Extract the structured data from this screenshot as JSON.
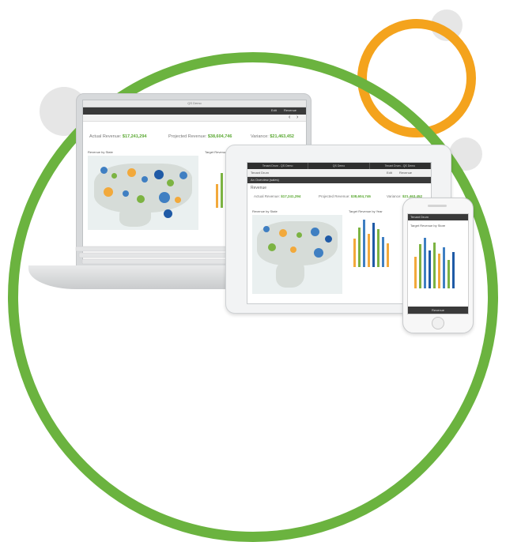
{
  "colors": {
    "green_arc": "#6bb33f",
    "orange_ring": "#f4a31d",
    "kpi_green": "#5aa832"
  },
  "laptop": {
    "window_title": "QS Demo",
    "toolbar_tabs": [
      "Edit",
      "Revenue"
    ],
    "kpis": [
      {
        "label": "Actual Revenue:",
        "value": "$17,241,294"
      },
      {
        "label": "Projected Revenue:",
        "value": "$38,604,746"
      },
      {
        "label": "Variance:",
        "value": "$21,463,452"
      }
    ],
    "map_title": "Revenue by State",
    "chart_title": "Target Revenue by Year",
    "nav_prev": "‹",
    "nav_next": "›"
  },
  "tablet": {
    "tabs": [
      "Tenant Drum - QS Demo",
      "QS Demo",
      "Tenant Drum - QS Demo"
    ],
    "app_name": "Tenant Drum",
    "toolbar_tabs": [
      "Edit",
      "Revenue"
    ],
    "breadcrumb": "An Overview (sales)",
    "section": "Revenue",
    "kpis": [
      {
        "label": "Actual Revenue:",
        "value": "$17,241,294"
      },
      {
        "label": "Projected Revenue:",
        "value": "$38,604,746"
      },
      {
        "label": "Variance:",
        "value": "$21,463,452"
      }
    ],
    "map_title": "Revenue by State",
    "chart_title": "Target Revenue by Year"
  },
  "phone": {
    "header": "Tenant Drum",
    "chart_title": "Target Revenue by Store",
    "footer": "Revenue"
  }
}
